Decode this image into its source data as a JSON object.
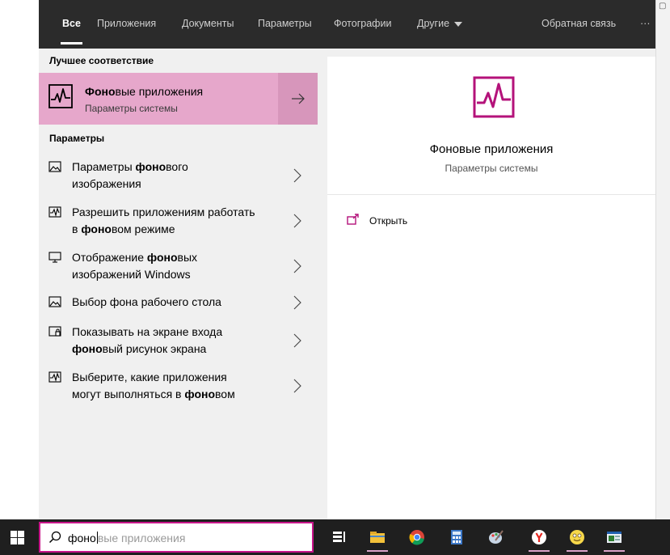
{
  "tabs": [
    {
      "label": "Все",
      "active": true
    },
    {
      "label": "Приложения"
    },
    {
      "label": "Документы"
    },
    {
      "label": "Параметры"
    },
    {
      "label": "Фотографии"
    },
    {
      "label": "Другие"
    }
  ],
  "feedback_label": "Обратная связь",
  "more_label": "···",
  "best_match": {
    "heading": "Лучшее соответствие",
    "title_bold": "Фоно",
    "title_rest": "вые приложения",
    "subtitle": "Параметры системы",
    "icon": "background-apps-icon"
  },
  "settings_section": {
    "heading": "Параметры",
    "items": [
      {
        "icon": "picture-icon",
        "l1": [
          {
            "t": "Параметры "
          },
          {
            "t": "фоно",
            "b": true
          },
          {
            "t": "вого"
          }
        ],
        "l2": [
          {
            "t": "изображения"
          }
        ]
      },
      {
        "icon": "background-apps-icon",
        "l1": [
          {
            "t": "Разрешить приложениям работать"
          }
        ],
        "l2": [
          {
            "t": "в "
          },
          {
            "t": "фоно",
            "b": true
          },
          {
            "t": "вом режиме"
          }
        ]
      },
      {
        "icon": "monitor-icon",
        "l1": [
          {
            "t": "Отображение "
          },
          {
            "t": "фоно",
            "b": true
          },
          {
            "t": "вых"
          }
        ],
        "l2": [
          {
            "t": "изображений Windows"
          }
        ]
      },
      {
        "icon": "picture-icon",
        "l1": [
          {
            "t": "Выбор фона рабочего стола"
          }
        ],
        "l2": []
      },
      {
        "icon": "lock-screen-icon",
        "l1": [
          {
            "t": "Показывать на экране входа"
          }
        ],
        "l2": [
          {
            "t": "фоно",
            "b": true
          },
          {
            "t": "вый рисунок экрана"
          }
        ]
      },
      {
        "icon": "background-apps-icon",
        "l1": [
          {
            "t": "Выберите, какие приложения"
          }
        ],
        "l2": [
          {
            "t": "могут выполняться в "
          },
          {
            "t": "фоно",
            "b": true
          },
          {
            "t": "вом"
          }
        ]
      }
    ]
  },
  "preview": {
    "title": "Фоновые приложения",
    "subtitle": "Параметры системы",
    "open_label": "Открыть"
  },
  "search": {
    "typed": "фоно",
    "suggestion": "вые приложения"
  },
  "taskbar_apps": [
    "task-view",
    "file-explorer",
    "chrome",
    "calculator",
    "paint",
    "yandex",
    "emoji-app",
    "window-app"
  ],
  "colors": {
    "accent": "#b4127a",
    "best_bg": "#e6a7cb",
    "topbar_bg": "#2b2b2b",
    "taskbar_bg": "#1f1f1f"
  }
}
